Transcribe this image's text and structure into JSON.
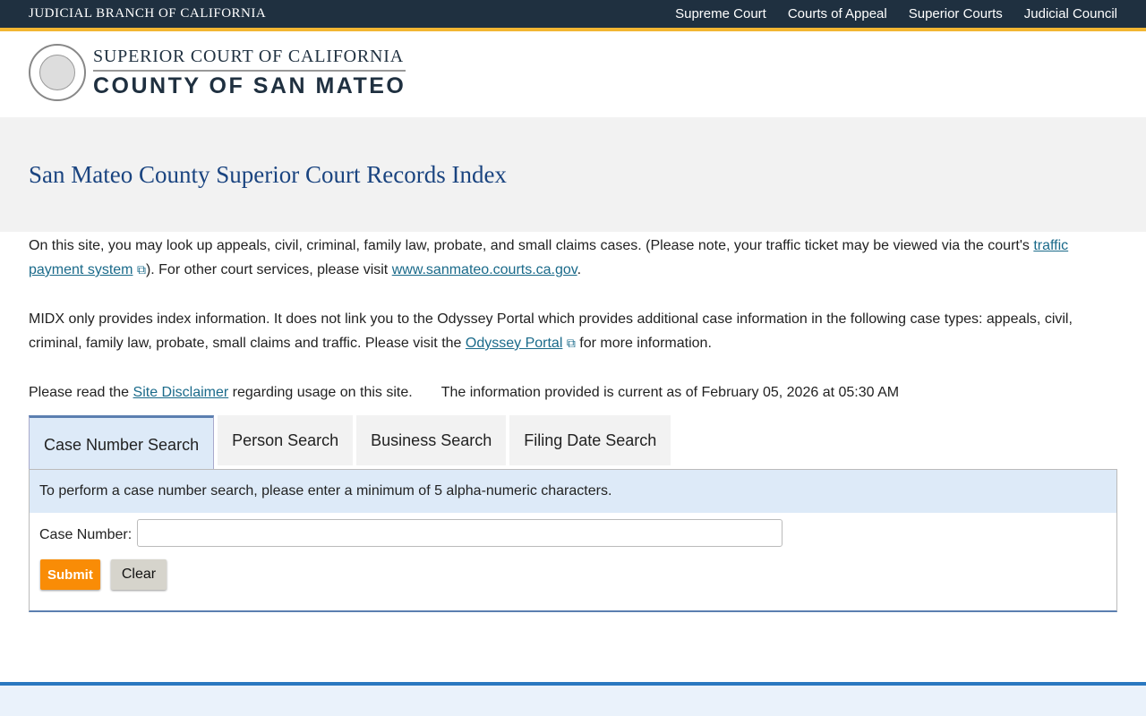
{
  "topbar": {
    "brand": "JUDICIAL BRANCH OF CALIFORNIA",
    "links": [
      "Supreme Court",
      "Courts of Appeal",
      "Superior Courts",
      "Judicial Council"
    ]
  },
  "logo": {
    "line1": "SUPERIOR COURT OF CALIFORNIA",
    "line2": "COUNTY OF SAN MATEO",
    "seal_text": "JUDICIAL BRANCH OF CALIFORNIA"
  },
  "page_title": "San Mateo County Superior Court Records Index",
  "intro": {
    "p1_a": "On this site, you may look up appeals, civil, criminal, family law, probate, and small claims cases. (Please note, your traffic ticket may be viewed via the court's ",
    "traffic_link": "traffic payment system",
    "p1_b": "). For other court services, please visit ",
    "court_link": "www.sanmateo.courts.ca.gov",
    "p1_c": ".",
    "p2_a": "MIDX only provides index information. It does not link you to the Odyssey Portal which provides additional case information in the following case types: appeals, civil, criminal, family law, probate, small claims and traffic. Please visit the ",
    "odyssey_link": "Odyssey Portal",
    "p2_b": " for more information.",
    "p3_a": "Please read the ",
    "disclaimer_link": "Site Disclaimer",
    "p3_b": " regarding usage on this site.",
    "current_info": "The information provided is current as of February 05, 2026 at 05:30 AM"
  },
  "tabs": [
    {
      "label": "Case Number Search",
      "active": true
    },
    {
      "label": "Person Search"
    },
    {
      "label": "Business Search"
    },
    {
      "label": "Filing Date Search"
    }
  ],
  "form": {
    "hint": "To perform a case number search, please enter a minimum of 5 alpha-numeric characters.",
    "case_label": "Case Number:",
    "case_value": "",
    "submit": "Submit",
    "clear": "Clear"
  },
  "icons": {
    "external": "external-link-icon"
  },
  "colors": {
    "accent": "#1a4480",
    "submit": "#f98c06",
    "topbar": "#1f3040",
    "gold": "#f2b632"
  }
}
